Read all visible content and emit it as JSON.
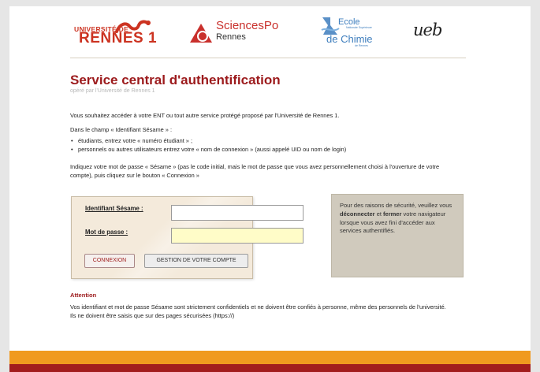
{
  "header": {
    "logos": {
      "rennes1": {
        "line1": "UNIVERSITÉ DE",
        "line2": "RENNES 1"
      },
      "sciencespo": {
        "line1": "SciencesPo",
        "line2": "Rennes"
      },
      "chimie": {
        "line1": "Ecole",
        "line2": "Nationale Supérieure",
        "line3": "de Chimie",
        "line4": "de Rennes"
      },
      "ueb": {
        "text": "ueb"
      }
    }
  },
  "main": {
    "title": "Service central d'authentification",
    "subtitle": "opéré par l'Université de Rennes 1",
    "intro": "Vous souhaitez accéder à votre ENT ou tout autre service protégé proposé par l'Université de Rennes 1.",
    "champ_intro": "Dans le champ « Identifiant Sésame » :",
    "bullets": [
      "étudiants, entrez votre « numéro étudiant » ;",
      "personnels ou autres utilisateurs entrez votre « nom de connexion » (aussi appelé UID ou nom de login)"
    ],
    "password_info": "Indiquez votre mot de passe « Sésame » (pas le code initial, mais le mot de passe que vous avez personnellement choisi à l'ouverture de votre compte), puis cliquez sur le bouton « Connexion »"
  },
  "login": {
    "id_label": "Identifiant Sésame :",
    "id_value": "",
    "password_label": "Mot de passe :",
    "password_value": "",
    "connexion_button": "CONNEXION",
    "gestion_button": "GESTION DE VOTRE COMPTE"
  },
  "security": {
    "part1": "Pour des raisons de sécurité, veuillez vous ",
    "bold1": "déconnecter",
    "part2": " et ",
    "bold2": "fermer",
    "part3": " votre navigateur lorsque vous avez fini d'accéder aux services authentifiés."
  },
  "attention": {
    "title": "Attention",
    "text": "Vos identifiant et mot de passe Sésame sont strictement confidentiels et ne doivent être confiés à personne, même des personnels de l'université. Ils ne doivent être saisis que sur des pages sécurisées (https://)"
  },
  "colors": {
    "title_red": "#9c1a1c",
    "footer_orange": "#f09a1f",
    "footer_red": "#a21d1d",
    "password_field_bg": "#fffcc8"
  }
}
